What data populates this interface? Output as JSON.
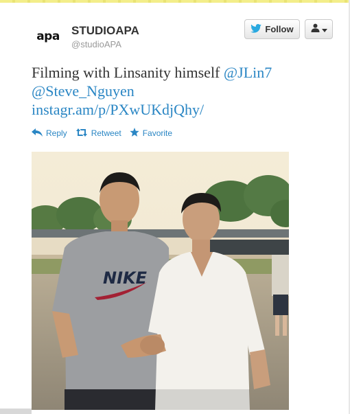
{
  "user": {
    "avatar_text": "apa",
    "name": "STUDIOAPA",
    "handle": "@studioAPA"
  },
  "buttons": {
    "follow_label": "Follow"
  },
  "tweet": {
    "text_prefix": "Filming with Linsanity himself ",
    "mention_1": "@JLin7",
    "mention_2": "@Steve_Nguyen",
    "link": "instagr.am/p/PXwUKdjQhy/"
  },
  "actions": {
    "reply": "Reply",
    "retweet": "Retweet",
    "favorite": "Favorite"
  },
  "photo": {
    "shirt_text": "NIKE"
  },
  "colors": {
    "link": "#2a86c4",
    "twitter_blue": "#2aa9e0"
  },
  "icons": [
    "twitter-bird-icon",
    "user-icon",
    "caret-down-icon",
    "reply-icon",
    "retweet-icon",
    "star-icon"
  ]
}
